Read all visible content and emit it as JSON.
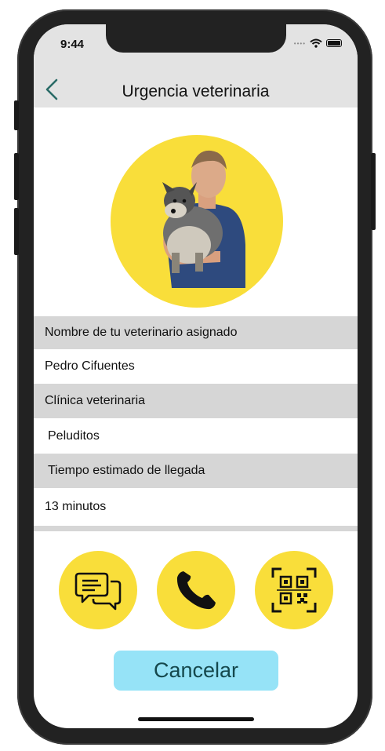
{
  "status_bar": {
    "time": "9:44"
  },
  "nav": {
    "title": "Urgencia veterinaria",
    "back_icon": "chevron-left-icon"
  },
  "details": {
    "vet_label": "Nombre de tu veterinario asignado",
    "vet_name": "Pedro Cifuentes",
    "clinic_label": "Clínica veterinaria",
    "clinic_name": "Peluditos",
    "eta_label": "Tiempo estimado de llegada",
    "eta_value": "13 minutos"
  },
  "actions": {
    "chat_icon": "chat-bubbles-icon",
    "call_icon": "phone-icon",
    "qr_icon": "qr-code-icon"
  },
  "cancel_label": "Cancelar",
  "colors": {
    "accent_yellow": "#f9de3a",
    "cancel_bg": "#96e3f7",
    "cancel_text": "#15484d",
    "nav_bg": "#e3e3e3",
    "section_bg": "#d6d6d6",
    "back_arrow": "#2a6b67"
  }
}
